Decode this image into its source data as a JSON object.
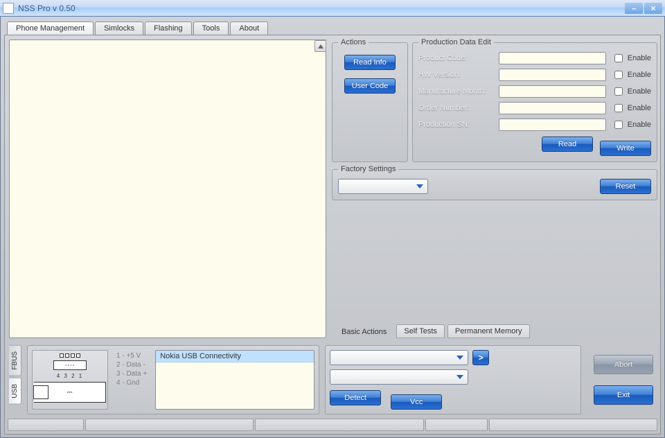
{
  "title": "NSS Pro v 0.50",
  "tabs": [
    "Phone Management",
    "Simlocks",
    "Flashing",
    "Tools",
    "About"
  ],
  "active_tab": 0,
  "actions": {
    "legend": "Actions",
    "read_info": "Read Info",
    "user_code": "User Code"
  },
  "pde": {
    "legend": "Production Data Edit",
    "rows": [
      {
        "label": "Product Code:",
        "value": "",
        "enable": "Enable"
      },
      {
        "label": "HW Version:",
        "value": "",
        "enable": "Enable"
      },
      {
        "label": "Manufacture Month:",
        "value": "",
        "enable": "Enable"
      },
      {
        "label": "Order Number:",
        "value": "",
        "enable": "Enable"
      },
      {
        "label": "Production SN:",
        "value": "",
        "enable": "Enable"
      }
    ],
    "read": "Read",
    "write": "Write"
  },
  "factory": {
    "legend": "Factory Settings",
    "reset": "Reset"
  },
  "subtabs": {
    "basic": "Basic Actions",
    "self_tests": "Self Tests",
    "perm_mem": "Permanent Memory"
  },
  "vert_tabs": [
    "FBUS",
    "USB"
  ],
  "pins": {
    "p1": "1 - +5 V",
    "p2": "2 - Data -",
    "p3": "3 - Data +",
    "p4": "4 - Gnd",
    "label4321": "4 3 2 1"
  },
  "device": "Nokia USB Connectivity",
  "detect": {
    "go": ">",
    "detect": "Detect",
    "vcc": "Vcc"
  },
  "right_buttons": {
    "abort": "Abort",
    "exit": "Exit"
  }
}
